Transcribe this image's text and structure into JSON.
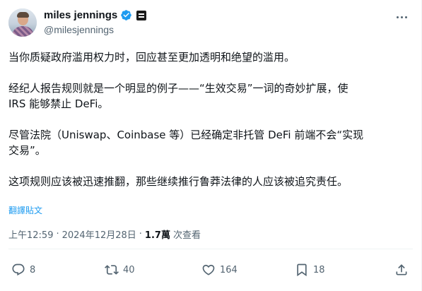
{
  "author": {
    "display_name": "miles jennings",
    "handle": "@milesjennings"
  },
  "tweet": {
    "paragraphs": [
      "当你质疑政府滥用权力时，回应甚至更加透明和绝望的滥用。",
      "经纪人报告规则就是一个明显的例子——“生效交易”一词的奇妙扩展，使\nIRS 能够禁止 DeFi。",
      "尽管法院（Uniswap、Coinbase 等）已经确定非托管 DeFi 前端不会“实现\n交易”。",
      "这项规则应该被迅速推翻，那些继续推行鲁莽法律的人应该被追究责任。"
    ],
    "translate_label": "翻譯貼文"
  },
  "meta": {
    "time": "上午12:59",
    "separator": "·",
    "date": "2024年12月28日",
    "separator2": "·",
    "views_count": "1.7萬",
    "views_label": "次查看"
  },
  "actions": {
    "replies": "8",
    "retweets": "40",
    "likes": "164",
    "bookmarks": "18"
  },
  "colors": {
    "accent": "#1d9bf0",
    "text": "#0f1419",
    "secondary": "#536471"
  }
}
